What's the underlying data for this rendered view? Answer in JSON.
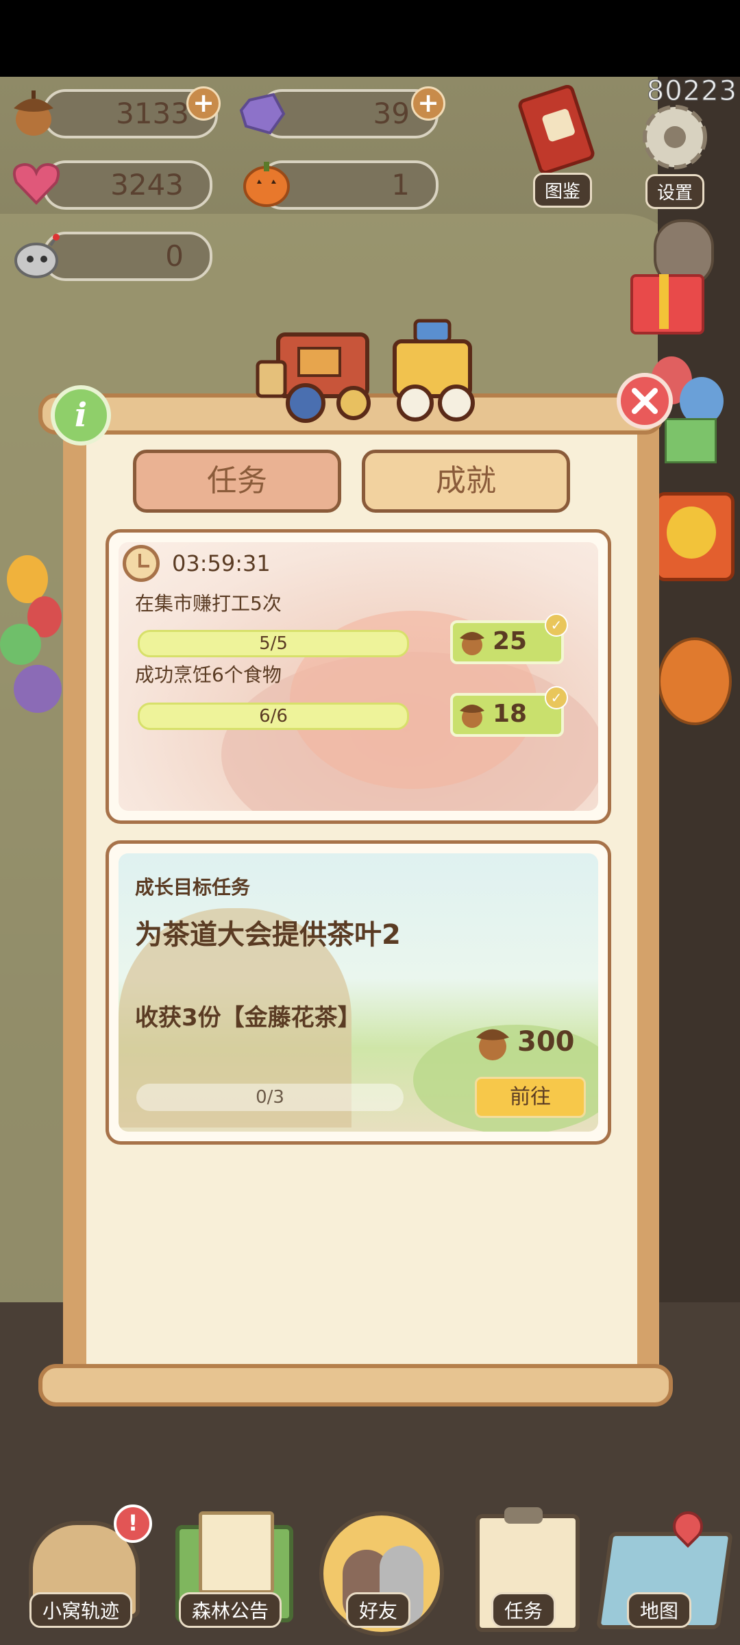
{
  "app": {
    "player_id": "80223"
  },
  "resources": {
    "acorns": "3133",
    "gems": "39",
    "hearts": "3243",
    "pumpkins": "1",
    "robot_parts": "0"
  },
  "side_buttons": {
    "encyclopedia_label": "图鉴",
    "settings_label": "设置"
  },
  "panel": {
    "tabs": [
      {
        "label": "任务"
      },
      {
        "label": "成就"
      }
    ],
    "daily": {
      "timer": "03:59:31",
      "tasks": [
        {
          "title": "在集市赚打工5次",
          "progress": "5/5",
          "progress_fraction": 1.0,
          "reward": "25"
        },
        {
          "title": "成功烹饪6个食物",
          "progress": "6/6",
          "progress_fraction": 1.0,
          "reward": "18"
        }
      ]
    },
    "growth": {
      "heading": "成长目标任务",
      "title": "为茶道大会提供茶叶2",
      "requirement": "收获3份【金藤花茶】",
      "reward": "300",
      "progress": "0/3",
      "progress_fraction": 0.0,
      "go_label": "前往"
    }
  },
  "nav": [
    {
      "label": "小窝轨迹"
    },
    {
      "label": "森林公告"
    },
    {
      "label": "好友"
    },
    {
      "label": "任务"
    },
    {
      "label": "地图"
    }
  ],
  "colors": {
    "panel_bg": "#f8efd8",
    "tab_task_active": "#eab293",
    "tab_achievement": "#f2d29f",
    "progress_fill": "#eef39a",
    "reward_green": "#c9e06d",
    "go_button": "#f7c84a"
  }
}
